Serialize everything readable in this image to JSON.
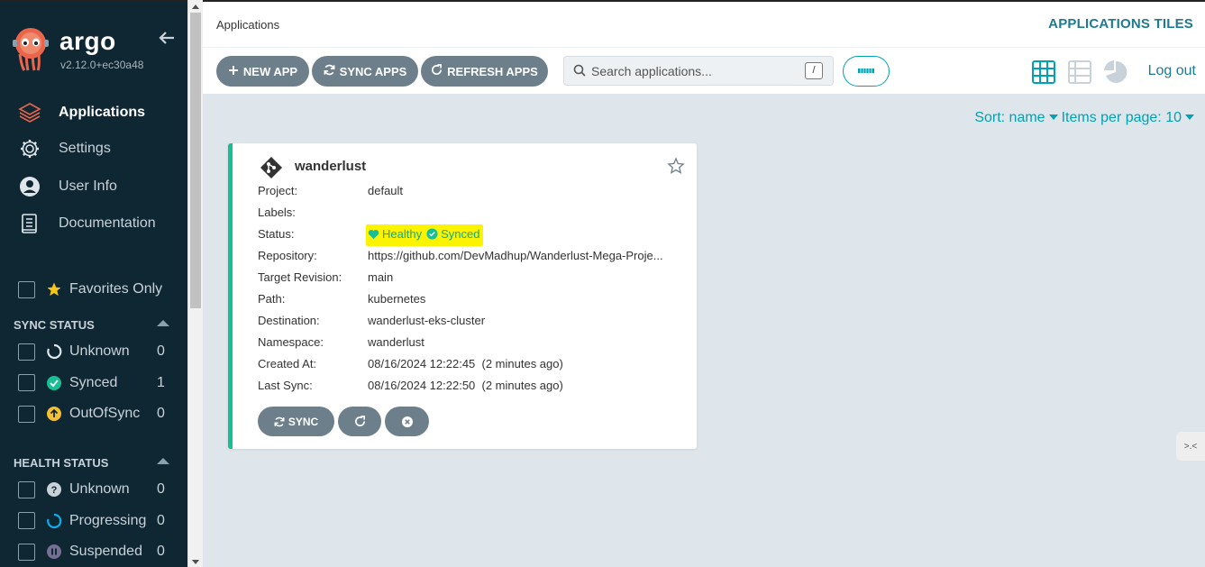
{
  "sidebar": {
    "logo_text": "argo",
    "version": "v2.12.0+ec30a48",
    "nav": [
      {
        "label": "Applications",
        "icon": "layers-icon",
        "active": true
      },
      {
        "label": "Settings",
        "icon": "gear-icon",
        "active": false
      },
      {
        "label": "User Info",
        "icon": "user-icon",
        "active": false
      },
      {
        "label": "Documentation",
        "icon": "book-icon",
        "active": false
      }
    ],
    "favorites_label": "Favorites Only",
    "sync_status": {
      "title": "SYNC STATUS",
      "items": [
        {
          "label": "Unknown",
          "count": "0",
          "icon": "circle-notch-icon"
        },
        {
          "label": "Synced",
          "count": "1",
          "icon": "check-circle-icon"
        },
        {
          "label": "OutOfSync",
          "count": "0",
          "icon": "arrow-up-circle-icon"
        }
      ]
    },
    "health_status": {
      "title": "HEALTH STATUS",
      "items": [
        {
          "label": "Unknown",
          "count": "0",
          "icon": "question-circle-icon"
        },
        {
          "label": "Progressing",
          "count": "0",
          "icon": "spinner-icon"
        },
        {
          "label": "Suspended",
          "count": "0",
          "icon": "pause-circle-icon"
        }
      ]
    }
  },
  "header": {
    "breadcrumb": "Applications",
    "title": "APPLICATIONS TILES",
    "logout": "Log out"
  },
  "toolbar": {
    "new_app": "NEW APP",
    "sync_apps": "SYNC APPS",
    "refresh_apps": "REFRESH APPS",
    "search_placeholder": "Search applications...",
    "search_shortcut": "/"
  },
  "sort": {
    "sort_label": "Sort: name",
    "per_page_label": "Items per page: 10"
  },
  "app_card": {
    "name": "wanderlust",
    "fields": [
      {
        "key": "Project:",
        "value": "default"
      },
      {
        "key": "Labels:",
        "value": ""
      },
      {
        "key": "Status:",
        "value": ""
      },
      {
        "key": "Repository:",
        "value": "https://github.com/DevMadhup/Wanderlust-Mega-Proje..."
      },
      {
        "key": "Target Revision:",
        "value": "main"
      },
      {
        "key": "Path:",
        "value": "kubernetes"
      },
      {
        "key": "Destination:",
        "value": "wanderlust-eks-cluster"
      },
      {
        "key": "Namespace:",
        "value": "wanderlust"
      },
      {
        "key": "Created At:",
        "value": "08/16/2024 12:22:45  (2 minutes ago)"
      },
      {
        "key": "Last Sync:",
        "value": "08/16/2024 12:22:50  (2 minutes ago)"
      }
    ],
    "health": "Healthy",
    "sync": "Synced",
    "sync_btn": "SYNC"
  },
  "colors": {
    "sidebar_bg": "#0f2733",
    "accent": "#00a2b3",
    "healthy": "#18be94",
    "button_bg": "#6d7f8b"
  }
}
